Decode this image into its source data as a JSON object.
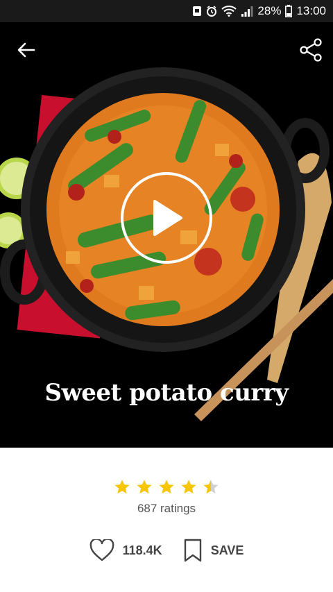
{
  "status_bar": {
    "battery_percent": "28%",
    "time": "13:00",
    "icons": [
      "notification-icon",
      "alarm-icon",
      "wifi-icon",
      "signal-icon",
      "battery-icon"
    ]
  },
  "header": {
    "back_icon": "arrow-left-icon",
    "share_icon": "share-icon"
  },
  "recipe": {
    "title": "Sweet potato curry",
    "rating_value": 4.5,
    "rating_max": 5,
    "ratings_label": "687 ratings",
    "likes": "118.4K",
    "save_label": "SAVE"
  },
  "colors": {
    "star": "#f7c600",
    "star_empty": "#d0d0d0",
    "curry": "#e07a1f",
    "pea": "#3c8b2c"
  }
}
